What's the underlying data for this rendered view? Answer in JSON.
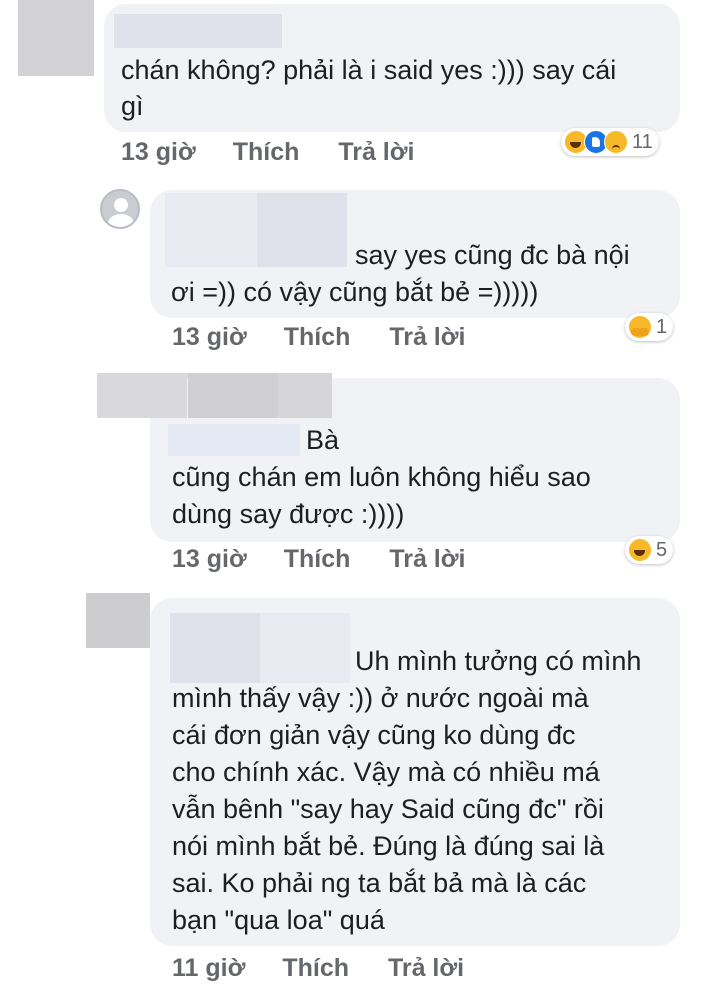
{
  "comments": [
    {
      "lines": [
        "chán không? phải là i said yes :))) say cái",
        "gì"
      ],
      "time": "13 giờ",
      "like_label": "Thích",
      "reply_label": "Trả lời",
      "reactions": [
        "haha",
        "like",
        "sad"
      ],
      "reaction_count": "11"
    },
    {
      "lines": [
        "say yes cũng đc bà nội",
        "ơi =)) có vậy cũng bắt bẻ =)))))"
      ],
      "time": "13 giờ",
      "like_label": "Thích",
      "reply_label": "Trả lời",
      "reactions": [
        "care"
      ],
      "reaction_count": "1"
    },
    {
      "lines": [
        "Bà",
        "cũng chán em luôn không hiểu sao",
        "dùng say được :))))"
      ],
      "time": "13 giờ",
      "like_label": "Thích",
      "reply_label": "Trả lời",
      "reactions": [
        "haha"
      ],
      "reaction_count": "5"
    },
    {
      "lines": [
        "Uh mình tưởng có mình",
        "mình thấy vậy :)) ở nước ngoài mà",
        "cái đơn giản vậy cũng ko dùng đc",
        "cho chính xác. Vậy mà có nhiều má",
        "vẫn bênh \"say hay Said cũng đc\" rồi",
        "nói mình bắt bẻ. Đúng là đúng sai là",
        "sai. Ko phải ng ta bắt bả mà là các",
        "bạn \"qua loa\" quá"
      ],
      "time": "11 giờ",
      "like_label": "Thích",
      "reply_label": "Trả lời"
    }
  ],
  "colors": {
    "bubble": "#f0f2f5",
    "meta_text": "#65676b",
    "body_text": "#1c1e21"
  },
  "icons": [
    "haha-reaction-icon",
    "like-reaction-icon",
    "sad-reaction-icon",
    "care-reaction-icon",
    "default-avatar-icon"
  ]
}
